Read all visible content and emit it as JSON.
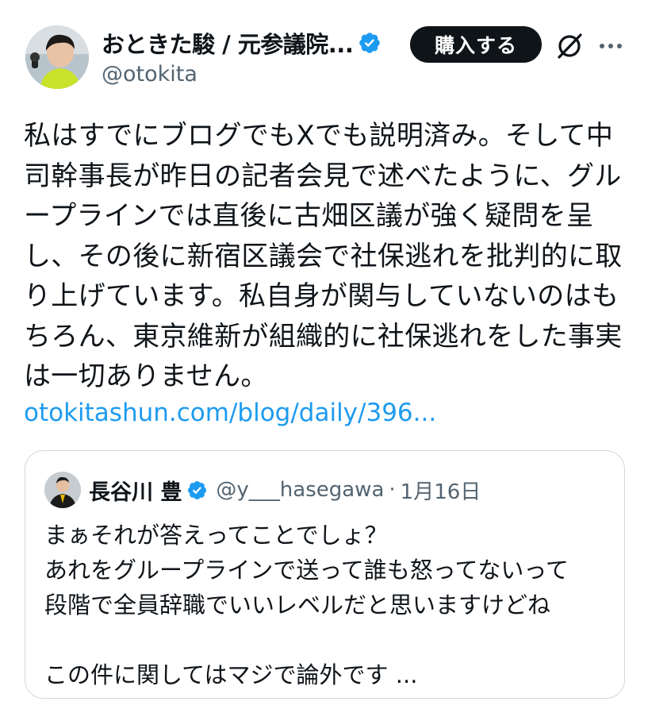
{
  "author": {
    "display_name": "おときた駿 / 元参議院...",
    "handle": "@otokita",
    "verified": true
  },
  "header": {
    "buy_label": "購入する",
    "grok_icon": "grok-slash-icon",
    "more_icon": "more-dots-icon"
  },
  "tweet": {
    "lines": [
      "私はすでにブログでもXでも説明済み。そして中",
      "司幹事長が昨日の記者会見で述べたように、グル",
      "ープラインでは直後に古畑区議が強く疑問を呈",
      "し、その後に新宿区議会で社保逃れを批判的に取",
      "り上げています。私自身が関与していないのはも",
      "ちろん、東京維新が組織的に社保逃れをした事実",
      "は一切ありません。"
    ],
    "link": "otokitashun.com/blog/daily/396..."
  },
  "quote": {
    "display_name": "長谷川 豊",
    "handle": "@y___hasegawa",
    "separator": "·",
    "date": "1月16日",
    "verified": true,
    "lines": [
      "まぁそれが答えってことでしょ？",
      "あれをグループラインで送って誰も怒ってないって",
      "段階で全員辞職でいいレベルだと思いますけどね",
      "",
      "この件に関してはマジで論外です ..."
    ]
  },
  "colors": {
    "text": "#0f1419",
    "secondary": "#536471",
    "link": "#1d9bf0",
    "verified": "#1d9bf0",
    "border": "#cfd9de",
    "button_bg": "#0f1419"
  }
}
